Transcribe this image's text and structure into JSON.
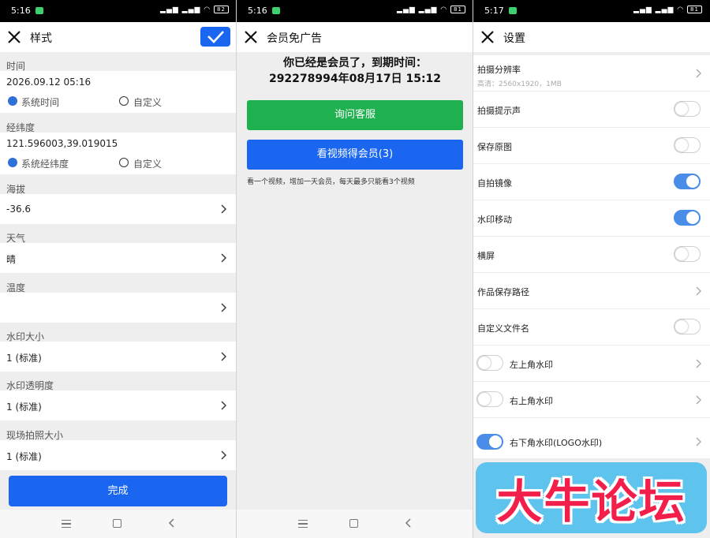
{
  "style_screen": {
    "status_time": "5:16",
    "battery": "82",
    "title": "样式",
    "time": {
      "label": "时间",
      "value": "2026.09.12 05:16",
      "opt_system": "系统时间",
      "opt_custom": "自定义"
    },
    "coords": {
      "label": "经纬度",
      "value": "121.596003,39.019015",
      "opt_system": "系统经纬度",
      "opt_custom": "自定义"
    },
    "altitude": {
      "label": "海拔",
      "value": "-36.6"
    },
    "weather": {
      "label": "天气",
      "value": "晴"
    },
    "temperature": {
      "label": "温度",
      "value": ""
    },
    "wm_size": {
      "label": "水印大小",
      "value": "1 (标准)"
    },
    "wm_opacity": {
      "label": "水印透明度",
      "value": "1 (标准)"
    },
    "photo_size": {
      "label": "现场拍照大小",
      "value": "1 (标准)"
    },
    "done_label": "完成"
  },
  "ad_screen": {
    "status_time": "5:16",
    "battery": "81",
    "title": "会员免广告",
    "member_line1": "你已经是会员了，到期时间：",
    "member_line2": "292278994年08月17日 15:12",
    "contact_button": "询问客服",
    "video_button": "看视频得会员(3)",
    "note": "看一个视频，增加一天会员，每天最多只能看3个视频"
  },
  "settings_screen": {
    "status_time": "5:17",
    "battery": "81",
    "title": "设置",
    "resolution": {
      "label": "拍摄分辨率",
      "sub": "高清：2560x1920，1MB"
    },
    "shutter_sound": {
      "label": "拍摄提示声",
      "on": false
    },
    "save_original": {
      "label": "保存原图",
      "on": false
    },
    "selfie_mirror": {
      "label": "自拍镜像",
      "on": true
    },
    "wm_move": {
      "label": "水印移动",
      "on": true
    },
    "landscape": {
      "label": "横屏",
      "on": false
    },
    "save_path": {
      "label": "作品保存路径"
    },
    "custom_filename": {
      "label": "自定义文件名",
      "on": false
    },
    "top_left_wm": {
      "label": "左上角水印",
      "on": false
    },
    "top_right_wm": {
      "label": "右上角水印",
      "on": false
    },
    "bottom_right_wm": {
      "label": "右下角水印(LOGO水印)",
      "on": true
    }
  },
  "watermark_text": "大牛论坛",
  "colors": {
    "accent_blue": "#1a66f0",
    "green": "#1fb04f",
    "toggle_on": "#4a8de8",
    "watermark_bg": "#5ec4ee",
    "watermark_text": "#f31f4b"
  }
}
